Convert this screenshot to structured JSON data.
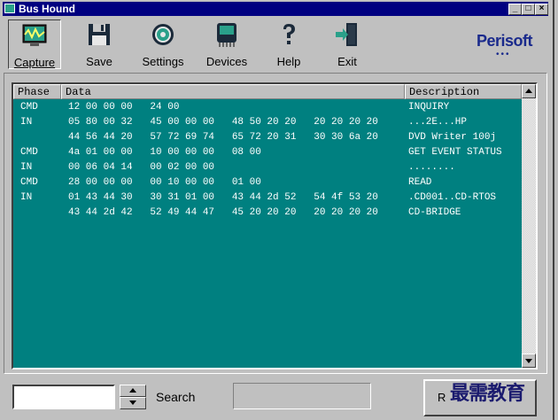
{
  "window": {
    "title": "Bus Hound"
  },
  "toolbar": {
    "capture": "Capture",
    "save": "Save",
    "settings": "Settings",
    "devices": "Devices",
    "help": "Help",
    "exit": "Exit"
  },
  "brand": {
    "name": "Perisoft",
    "dots": "•••"
  },
  "table": {
    "headers": {
      "phase": "Phase",
      "data": "Data",
      "description": "Description"
    },
    "rows": [
      {
        "phase": "CMD",
        "data": "12 00 00 00   24 00",
        "desc": "INQUIRY"
      },
      {
        "phase": "IN",
        "data": "05 80 00 32   45 00 00 00   48 50 20 20   20 20 20 20",
        "desc": "...2E...HP"
      },
      {
        "phase": "",
        "data": "44 56 44 20   57 72 69 74   65 72 20 31   30 30 6a 20",
        "desc": "DVD Writer 100j"
      },
      {
        "phase": "CMD",
        "data": "4a 01 00 00   10 00 00 00   08 00",
        "desc": "GET EVENT STATUS"
      },
      {
        "phase": "IN",
        "data": "00 06 04 14   00 02 00 00",
        "desc": "........"
      },
      {
        "phase": "CMD",
        "data": "28 00 00 00   00 10 00 00   01 00",
        "desc": "READ"
      },
      {
        "phase": "IN",
        "data": "01 43 44 30   30 31 01 00   43 44 2d 52   54 4f 53 20",
        "desc": ".CD001..CD-RTOS"
      },
      {
        "phase": "",
        "data": "43 44 2d 42   52 49 44 47   45 20 20 20   20 20 20 20",
        "desc": "CD-BRIDGE"
      }
    ]
  },
  "search": {
    "label": "Search",
    "value": ""
  },
  "bottom_button": {
    "label": "R"
  },
  "watermark": {
    "text": "最需教育"
  }
}
